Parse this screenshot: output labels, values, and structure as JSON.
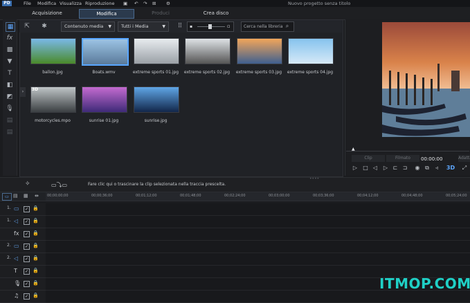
{
  "menu": {
    "items": [
      "File",
      "Modifica",
      "Visualizza",
      "Riproduzione"
    ],
    "project_title": "Nuovo progetto senza titolo"
  },
  "tabs": [
    {
      "label": "Acquisizione",
      "state": "normal"
    },
    {
      "label": "Modifica",
      "state": "active"
    },
    {
      "label": "Produci",
      "state": "disabled"
    },
    {
      "label": "Crea disco",
      "state": "normal"
    }
  ],
  "library": {
    "filter_type": "Contenuto media",
    "filter_all": "Tutti i Media",
    "search_placeholder": "Cerca nella libreria",
    "items": [
      {
        "name": "ballon.jpg",
        "colors": [
          "#7ab9e8",
          "#4a8a2a"
        ],
        "selected": false
      },
      {
        "name": "Boats.wmv",
        "colors": [
          "#9cc3e4",
          "#5a7a9a"
        ],
        "selected": true
      },
      {
        "name": "extreme sports 01.jpg",
        "colors": [
          "#e8ecef",
          "#9aa0a6"
        ],
        "selected": false
      },
      {
        "name": "extreme sports 02.jpg",
        "colors": [
          "#dfe3e6",
          "#555"
        ],
        "selected": false
      },
      {
        "name": "extreme sports 03.jpg",
        "colors": [
          "#f2a65a",
          "#3f5f8f"
        ],
        "selected": false
      },
      {
        "name": "extreme sports 04.jpg",
        "colors": [
          "#86c3ee",
          "#d6e9f7"
        ],
        "selected": false
      },
      {
        "name": "motorcycles.mpo",
        "colors": [
          "#bfc5c7",
          "#3b3f42"
        ],
        "selected": false,
        "badge": "3D"
      },
      {
        "name": "sunrise 01.jpg",
        "colors": [
          "#c46bd0",
          "#3e2a78"
        ],
        "selected": false
      },
      {
        "name": "sunrise.jpg",
        "colors": [
          "#5fa6e6",
          "#12264a"
        ],
        "selected": false
      }
    ]
  },
  "preview": {
    "time": "00:00:00",
    "clip_label": "Clip",
    "film_label": "Filmato",
    "adapt_label": "Adatta"
  },
  "edit_bar": {
    "hint": "Fare clic qui o trascinare la clip selezionata nella traccia prescelta."
  },
  "timeline": {
    "ticks": [
      "00;00;00;00",
      "00;00;36;00",
      "00;01;12;00",
      "00;01;48;00",
      "00;02;24;00",
      "00;03;00;00",
      "00;03;36;00",
      "00;04;12;00",
      "00;04;48;00",
      "00;05;24;00"
    ],
    "tracks": [
      {
        "num": "1.",
        "icon": "video-track-icon",
        "glyph": "▭"
      },
      {
        "num": "1.",
        "icon": "audio-track-icon",
        "glyph": "◁"
      },
      {
        "num": "",
        "icon": "fx-track-icon",
        "glyph": "fx"
      },
      {
        "num": "2.",
        "icon": "video-track-icon",
        "glyph": "▭"
      },
      {
        "num": "2.",
        "icon": "audio-track-icon",
        "glyph": "◁"
      },
      {
        "num": "",
        "icon": "title-track-icon",
        "glyph": "T"
      },
      {
        "num": "",
        "icon": "voice-track-icon",
        "glyph": "🎙"
      },
      {
        "num": "",
        "icon": "music-track-icon",
        "glyph": "♫"
      }
    ]
  },
  "watermark": "ITMOP.COM"
}
